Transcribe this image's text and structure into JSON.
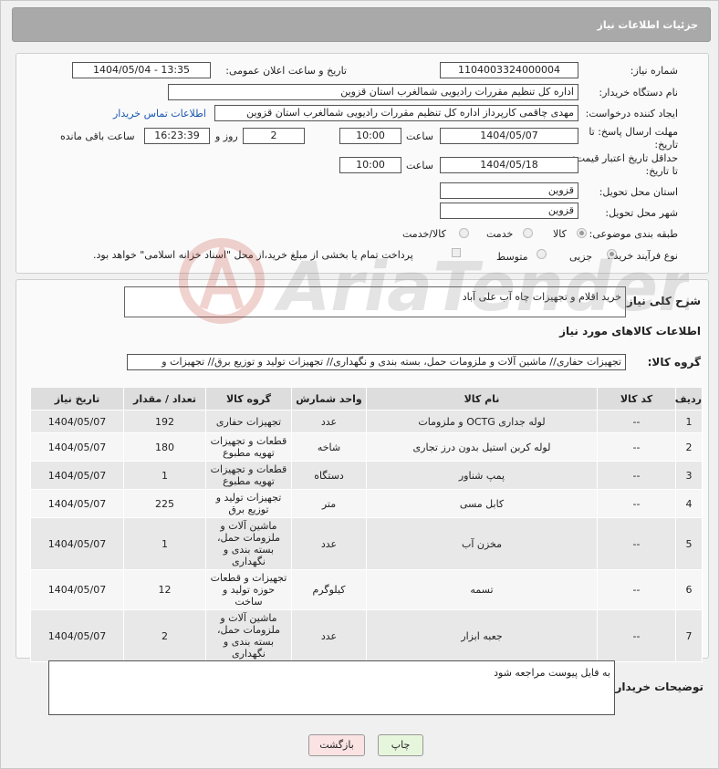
{
  "header": {
    "title": "جزئیات اطلاعات نیاز"
  },
  "form": {
    "need_number_label": "شماره نیاز:",
    "need_number": "1104003324000004",
    "announce_label": "تاریخ و ساعت اعلان عمومی:",
    "announce_value": "1404/05/04 - 13:35",
    "buyer_label": "نام دستگاه خریدار:",
    "buyer_value": "اداره کل تنظیم مقررات رادیویی شمالغرب استان قزوین",
    "creator_label": "ایجاد کننده درخواست:",
    "creator_value": "مهدی  چاقمی کارپرداز اداره کل تنظیم مقررات رادیویی شمالغرب استان قزوین",
    "contact_link": "اطلاعات تماس خریدار",
    "deadline_label": "مهلت ارسال پاسخ: تا تاریخ:",
    "deadline_date": "1404/05/07",
    "time_label": "ساعت",
    "deadline_time": "10:00",
    "days_value": "2",
    "days_label": "روز و",
    "remaining_value": "16:23:39",
    "remaining_label": "ساعت باقی مانده",
    "validity_label": "حداقل تاریخ اعتبار قیمت: تا تاریخ:",
    "validity_date": "1404/05/18",
    "validity_time": "10:00",
    "province_label": "استان محل تحویل:",
    "province_value": "قزوین",
    "city_label": "شهر محل تحویل:",
    "city_value": "قزوین",
    "category_label": "طبقه بندی موضوعی:",
    "category_options": [
      "کالا",
      "خدمت",
      "کالا/خدمت"
    ],
    "category_selected": "کالا",
    "process_label": "نوع فرآیند خرید :",
    "process_options": [
      "جزیی",
      "متوسط"
    ],
    "process_selected": "جزیی",
    "payment_note": "پرداخت تمام یا بخشی از مبلغ خرید،از محل \"اسناد خزانه اسلامی\" خواهد بود."
  },
  "description": {
    "label": "شرح کلی نیاز:",
    "value": "خرید اقلام و تجهیزات چاه آب علی آباد"
  },
  "goods_info": {
    "title": "اطلاعات کالاهای مورد نیاز",
    "group_label": "گروه کالا:",
    "group_value": "تجهیزات حفاری// ماشین آلات و ملزومات حمل، بسته بندی و نگهداری// تجهیزات تولید و توزیع برق// تجهیزات و"
  },
  "table": {
    "headers": [
      "ردیف",
      "کد کالا",
      "نام کالا",
      "واحد شمارش",
      "گروه کالا",
      "تعداد / مقدار",
      "تاریخ نیاز"
    ],
    "rows": [
      {
        "row": "1",
        "code": "--",
        "name": "لوله جداری OCTG و ملزومات",
        "unit": "عدد",
        "group": "تجهیزات حفاری",
        "qty": "192",
        "date": "1404/05/07"
      },
      {
        "row": "2",
        "code": "--",
        "name": "لوله کربن استیل بدون درز تجاری",
        "unit": "شاخه",
        "group": "قطعات و تجهیزات تهویه مطبوع",
        "qty": "180",
        "date": "1404/05/07"
      },
      {
        "row": "3",
        "code": "--",
        "name": "پمپ شناور",
        "unit": "دستگاه",
        "group": "قطعات و تجهیزات تهویه مطبوع",
        "qty": "1",
        "date": "1404/05/07"
      },
      {
        "row": "4",
        "code": "--",
        "name": "کابل مسی",
        "unit": "متر",
        "group": "تجهیزات تولید و توزیع برق",
        "qty": "225",
        "date": "1404/05/07"
      },
      {
        "row": "5",
        "code": "--",
        "name": "مخزن آب",
        "unit": "عدد",
        "group": "ماشین آلات و ملزومات حمل، بسته بندی و نگهداری",
        "qty": "1",
        "date": "1404/05/07"
      },
      {
        "row": "6",
        "code": "--",
        "name": "تسمه",
        "unit": "کیلوگرم",
        "group": "تجهیزات و قطعات حوزه تولید و ساخت",
        "qty": "12",
        "date": "1404/05/07"
      },
      {
        "row": "7",
        "code": "--",
        "name": "جعبه ابزار",
        "unit": "عدد",
        "group": "ماشین آلات و ملزومات حمل، بسته بندی و نگهداری",
        "qty": "2",
        "date": "1404/05/07"
      }
    ]
  },
  "buyer_notes": {
    "label": "توضیحات خریدار:",
    "value": "به فایل پیوست مراجعه شود"
  },
  "buttons": {
    "print": "چاپ",
    "back": "بازگشت"
  },
  "watermark": {
    "text": "AriaTender.net"
  }
}
